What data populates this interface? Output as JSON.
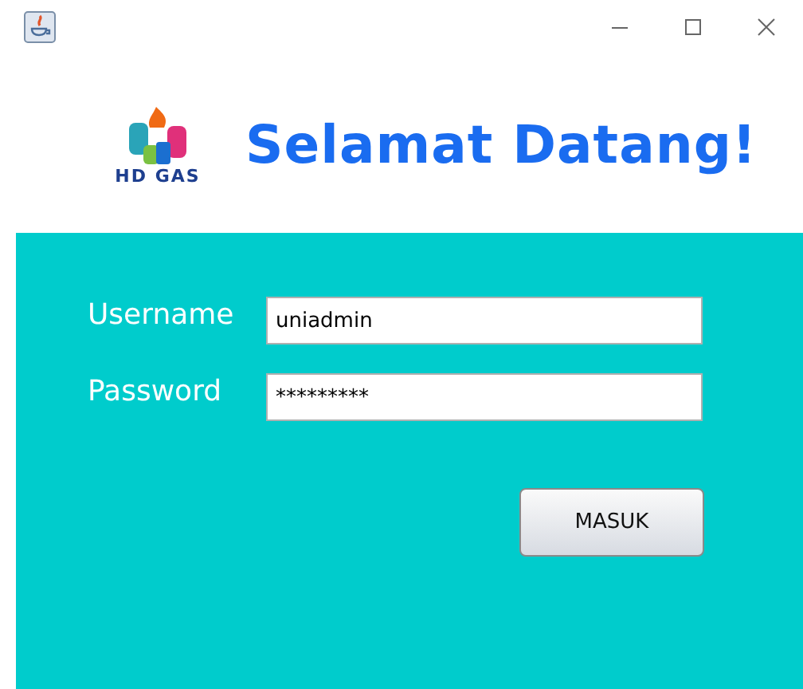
{
  "header": {
    "logo_text": "HD GAS",
    "title": "Selamat Datang!"
  },
  "form": {
    "fields": [
      {
        "label": "Username",
        "value": "uniadmin"
      },
      {
        "label": "Password",
        "value": "*********"
      }
    ],
    "button": "MASUK"
  }
}
